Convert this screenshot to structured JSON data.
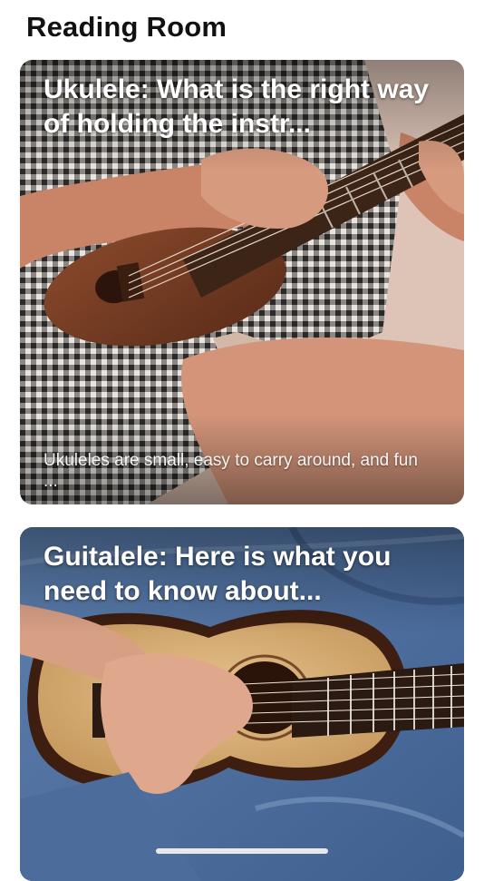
{
  "header": {
    "title": "Reading Room"
  },
  "articles": [
    {
      "title": "Ukulele: What is the right way of holding the instr...",
      "description": "Ukuleles are small, easy to carry around, and fun ...",
      "image": "ukulele-photo"
    },
    {
      "title": "Guitalele: Here is what you need to know about...",
      "description": "",
      "image": "guitalele-photo"
    }
  ],
  "colors": {
    "background": "#ffffff",
    "title_text": "#111111",
    "card_text": "#ffffff"
  }
}
